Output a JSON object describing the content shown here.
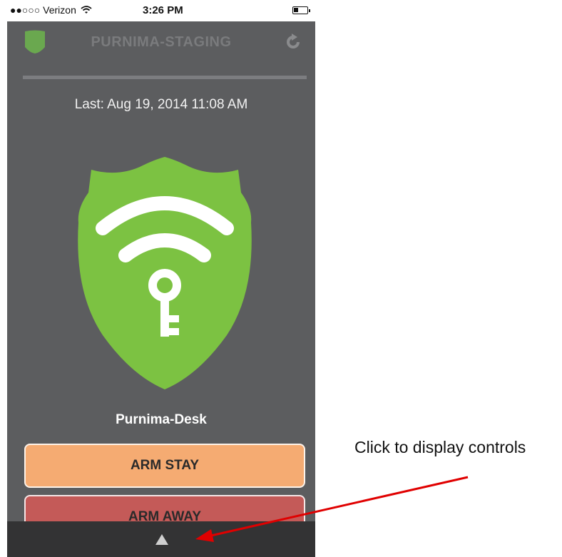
{
  "status_bar": {
    "carrier": "●●○○○ Verizon",
    "wifi_icon": "wifi-icon",
    "time": "3:26 PM",
    "battery_icon": "battery-icon"
  },
  "header": {
    "title": "PURNIMA-STAGING",
    "logo_icon": "shield-logo-icon",
    "refresh_icon": "refresh-icon"
  },
  "status": {
    "last_update": "Last: Aug 19, 2014 11:08 AM",
    "shield_icon": "wifi-key-shield-icon"
  },
  "device": {
    "name": "Purnima-Desk"
  },
  "controls": {
    "arm_stay_label": "ARM STAY",
    "arm_away_label": "ARM AWAY",
    "toggle_icon": "triangle-up-icon"
  },
  "annotation": {
    "text": "Click to display controls"
  },
  "colors": {
    "background": "#5c5d5f",
    "shield_green": "#7cc242",
    "arm_stay": "#f5ab72",
    "arm_away": "#c45a58",
    "bottom_bar": "#333334",
    "arrow": "#e00000"
  }
}
